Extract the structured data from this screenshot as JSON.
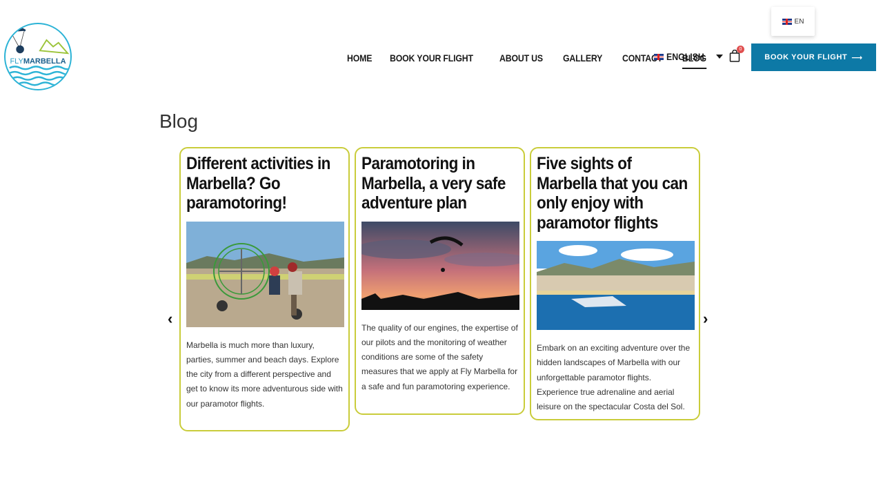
{
  "lang_popup": {
    "code": "EN"
  },
  "logo": {
    "fly": "FLY",
    "marbella": "MARBELLA"
  },
  "nav": {
    "items": [
      "HOME",
      "BOOK YOUR FLIGHT",
      "ABOUT US",
      "GALLERY",
      "CONTACT",
      "BLOG"
    ],
    "active": "BLOG",
    "language": "ENGLISH"
  },
  "cart": {
    "count": "0"
  },
  "cta": {
    "label": "BOOK YOUR FLIGHT",
    "arrow": "⟶"
  },
  "page": {
    "title": "Blog"
  },
  "carousel": {
    "prev": "‹",
    "next": "›",
    "cards": [
      {
        "title": "Different activities in Marbella? Go paramotoring!",
        "text": "Marbella is much more than luxury, parties, summer and beach days. Explore the city from a different perspective and get to know its more adventurous side with our paramotor flights."
      },
      {
        "title": "Paramotoring in Marbella, a very safe adventure plan",
        "text": "The quality of our engines, the expertise of our pilots and the monitoring of weather conditions are some of the safety measures that we apply at Fly Marbella for a safe and fun paramotoring experience."
      },
      {
        "title": "Five sights of Marbella that you can only enjoy with paramotor flights",
        "text": "Embark on an exciting adventure over the hidden landscapes of Marbella with our unforgettable paramotor flights. Experience true adrenaline and aerial leisure on the spectacular Costa del Sol."
      }
    ]
  },
  "colors": {
    "accent": "#0d79a6",
    "card_border": "#c9cc3a",
    "badge": "#e05050"
  }
}
